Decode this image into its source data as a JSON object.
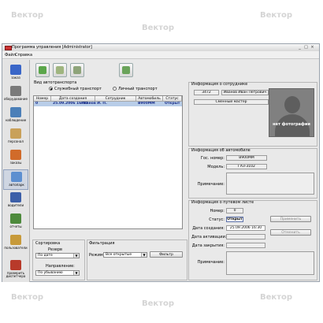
{
  "window": {
    "title": "Программа управления [Administrator]",
    "controls": [
      "_",
      "□",
      "×"
    ]
  },
  "menu": [
    "Файл",
    "Справка"
  ],
  "sidebar": {
    "items": [
      {
        "label": "заказ",
        "icon": "order-icon",
        "color": "#3a66c8"
      },
      {
        "label": "оборудование",
        "icon": "equipment-icon",
        "color": "#7a7a7a"
      },
      {
        "label": "наблюдение",
        "icon": "monitoring-icon",
        "color": "#4b7fb8"
      },
      {
        "label": "персонал",
        "icon": "personnel-icon",
        "color": "#c9a15a"
      },
      {
        "label": "заказы",
        "icon": "orders-icon",
        "color": "#d16b2a"
      },
      {
        "label": "автопарк",
        "icon": "fleet-icon",
        "color": "#5d8fd0"
      },
      {
        "label": "водители",
        "icon": "drivers-icon",
        "color": "#3c5fa8"
      },
      {
        "label": "отчеты",
        "icon": "reports-icon",
        "color": "#4d8a3c"
      },
      {
        "label": "пользователи",
        "icon": "users-icon",
        "color": "#c79a3a"
      },
      {
        "label": "проверить диспетчера",
        "icon": "check-dispatcher-icon",
        "color": "#b83a2a"
      }
    ]
  },
  "toolbar": {
    "buttons": [
      {
        "name": "add-vehicle",
        "icon": "add-car-icon"
      },
      {
        "name": "edit-vehicle",
        "icon": "edit-car-icon"
      },
      {
        "name": "delete-vehicle",
        "icon": "delete-car-icon"
      },
      {
        "name": "refresh",
        "icon": "handshake-icon"
      }
    ]
  },
  "transport_type": {
    "title": "Вид автотранспорта",
    "options": [
      "Служебный транспорт",
      "Личный транспорт"
    ],
    "selected": 0
  },
  "table": {
    "columns": [
      "Номер",
      "Дата создания",
      "Сотрудник",
      "Автомобиль",
      "Статус"
    ],
    "rows": [
      [
        "0",
        "25.09.2006 16:30",
        "Иванов И. П.",
        "В900ММ",
        "Открыт"
      ]
    ]
  },
  "sorting": {
    "title": "Сортировка",
    "field_label": "Резерв",
    "field_value": "По дате",
    "direction_label": "Направление:",
    "direction_value": "По убыванию"
  },
  "filtering": {
    "title": "Фильтрация",
    "label": "Режим",
    "value": "Все открытые",
    "button": "Фильтр"
  },
  "employee": {
    "title": "Информация о сотруднике",
    "id": "3472",
    "name": "Иванов Иван Петрович",
    "position": "Сменный мастер",
    "photo_text": "нет фотографии"
  },
  "vehicle": {
    "title": "Информация об автомобиле",
    "plate_label": "Гос. номер:",
    "plate": "В900ММ",
    "model_label": "Модель:",
    "model": "ГАЗ-3102",
    "note_label": "Примечание:"
  },
  "waybill": {
    "title": "Информация о путевом листе",
    "number_label": "Номер:",
    "number": "0",
    "status_label": "Статус:",
    "status": "Открыт",
    "created_label": "Дата создания:",
    "created": "25.09.2006 16:30",
    "activated_label": "Дата активации:",
    "closed_label": "Дата закрытия:",
    "note_label": "Примечание:",
    "apply_button": "Применить",
    "cancel_button": "Отменить"
  },
  "watermark": "Вектор"
}
